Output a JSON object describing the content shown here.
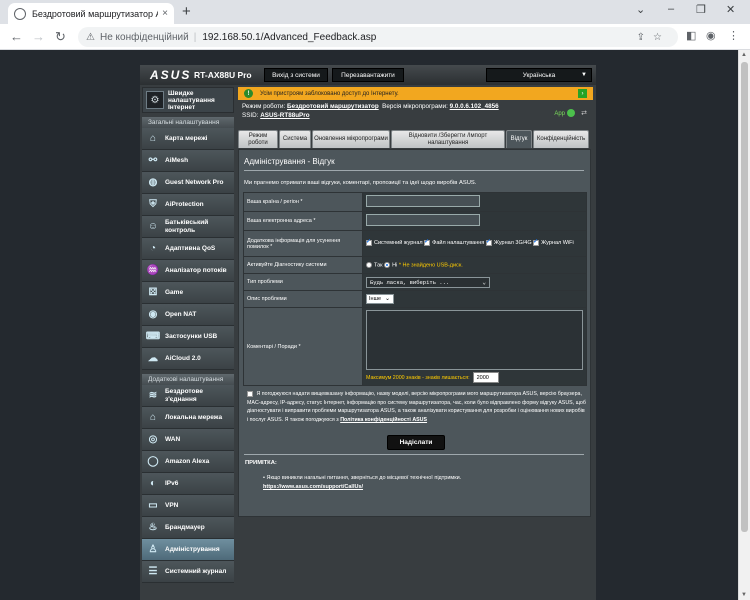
{
  "browser": {
    "tab_title": "Бездротовий маршрутизатор ASUS",
    "tab_close": "×",
    "new_tab": "+",
    "win_min": "⌄",
    "win_controls": [
      "–",
      "❐",
      "✕"
    ],
    "not_secure": "Не конфіденційний",
    "separator": "|",
    "url": "192.168.50.1/Advanced_Feedback.asp"
  },
  "router": {
    "brand": "ASUS",
    "model": "RT-AX88U Pro",
    "logout_button": "Вихід з системи",
    "reboot_button": "Перезавантажити",
    "language": "Українська",
    "status_message": "Усім пристроям заблоковано доступ до Інтернету.",
    "info": {
      "mode_label": "Режим роботи:",
      "mode_value": "Бездротовий маршрутизатор",
      "fw_label": "Версія мікропрограми:",
      "fw_value": "9.0.0.6.102_4856",
      "ssid_label": "SSID:",
      "ssid_value": "ASUS-RT88uPro",
      "app_label": "App"
    }
  },
  "sidebar": {
    "quick_setup": "Швидке налаштування Інтернет",
    "general_header": "Загальні налаштування",
    "general_items": [
      {
        "label": "Карта мережі",
        "icon": "network-map-icon",
        "glyph": "⌂"
      },
      {
        "label": "AiMesh",
        "icon": "aimesh-icon",
        "glyph": "⚯"
      },
      {
        "label": "Guest Network Pro",
        "icon": "guest-network-icon",
        "glyph": "◍"
      },
      {
        "label": "AiProtection",
        "icon": "shield-icon",
        "glyph": "⛨"
      },
      {
        "label": "Батьківський контроль",
        "icon": "parental-control-icon",
        "glyph": "☺"
      },
      {
        "label": "Адаптивна QoS",
        "icon": "qos-icon",
        "glyph": "◔"
      },
      {
        "label": "Аналізатор потоків",
        "icon": "traffic-analyzer-icon",
        "glyph": "♒"
      },
      {
        "label": "Game",
        "icon": "game-icon",
        "glyph": "⚄"
      },
      {
        "label": "Open NAT",
        "icon": "open-nat-icon",
        "glyph": "◉"
      },
      {
        "label": "Застосунки USB",
        "icon": "usb-icon",
        "glyph": "⌨"
      },
      {
        "label": "AiCloud 2.0",
        "icon": "cloud-icon",
        "glyph": "☁"
      }
    ],
    "advanced_header": "Додаткові налаштування",
    "advanced_items": [
      {
        "label": "Бездротове з'єднання",
        "icon": "wireless-icon",
        "glyph": "≋"
      },
      {
        "label": "Локальна мережа",
        "icon": "lan-icon",
        "glyph": "⌂"
      },
      {
        "label": "WAN",
        "icon": "wan-icon",
        "glyph": "◎"
      },
      {
        "label": "Amazon Alexa",
        "icon": "alexa-icon",
        "glyph": "◯"
      },
      {
        "label": "IPv6",
        "icon": "ipv6-icon",
        "glyph": "◐"
      },
      {
        "label": "VPN",
        "icon": "vpn-icon",
        "glyph": "▭"
      },
      {
        "label": "Брандмауер",
        "icon": "firewall-icon",
        "glyph": "♨"
      },
      {
        "label": "Адміністрування",
        "icon": "administration-icon",
        "glyph": "♙"
      },
      {
        "label": "Системний журнал",
        "icon": "system-log-icon",
        "glyph": "☰"
      }
    ]
  },
  "tabs": [
    {
      "label": "Режим роботи",
      "w": 40
    },
    {
      "label": "Система",
      "w": 32
    },
    {
      "label": "Оновлення мікропрограми",
      "w": 78
    },
    {
      "label": "Відновити /Зберегти /Імпорт налаштування",
      "w": 114
    },
    {
      "label": "Відгук",
      "w": 26,
      "active": true
    },
    {
      "label": "Конфіденційність",
      "w": 56
    }
  ],
  "form": {
    "title": "Адміністрування - Відгук",
    "description": "Ми прагнемо отримати ваші відгуки, коментарі, пропозиції та ідеї щодо виробів ASUS.",
    "country_label": "Ваша країна / регіон *",
    "email_label": "Ваша електронна адреса *",
    "extra_label": "Додаткова інформація для усунення помилок *",
    "extra_options": [
      "Системний журнал",
      "Файл налаштування",
      "Журнал 3G/4G",
      "Журнал WiFi"
    ],
    "diag_label": "Активуйте Діагностику системи",
    "diag_yes": "Так",
    "diag_no": "Ні",
    "diag_note": "* Не знайдено USB-диск.",
    "problem_type_label": "Тип проблеми",
    "problem_type_value": "Будь ласка, виберіть ...",
    "problem_desc_label": "Опис проблеми",
    "problem_desc_value": "Інше",
    "comments_label": "Коментарі / Поради *",
    "max_length_note": "Максимум 2000 знаків - знаків лишається:",
    "chars_left": "2000",
    "consent_text": "Я погоджуюся надати вищевказану інформацію, назву моделі, версію мікропрограми мого маршрутизатора ASUS, версію браузера, MAC-адресу, IP-адресу, статус Інтернет, інформацію про систему маршрутизатора, час, коли було відправлено форму відгуку ASUS, щоб діагностувати і виправити проблеми маршрутизатора ASUS, а також аналізувати користування для розробки і оцінювання нових виробів і послуг ASUS. Я також погоджуюся з",
    "consent_link": "Політика конфіденційності ASUS",
    "submit": "Надіслати",
    "note_title": "ПРИМІТКА:",
    "note_text": "Якщо виникли нагальні питання, зверніться до місцевої технічної підтримки.",
    "note_link": "https://www.asus.com/support/CallUs/"
  }
}
